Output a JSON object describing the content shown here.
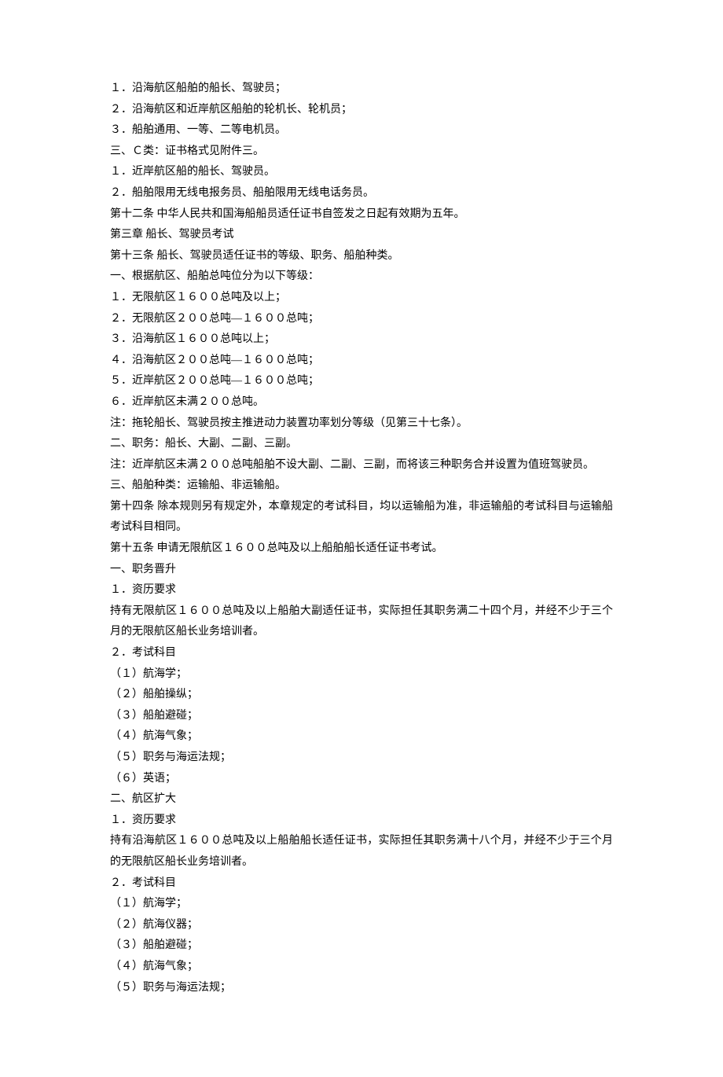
{
  "lines": [
    "１．沿海航区船舶的船长、驾驶员；",
    "２．沿海航区和近岸航区船舶的轮机长、轮机员；",
    "３．船舶通用、一等、二等电机员。",
    "三、Ｃ类：证书格式见附件三。",
    "１．近岸航区船的船长、驾驶员。",
    "２．船舶限用无线电报务员、船舶限用无线电话务员。",
    "第十二条 中华人民共和国海船船员适任证书自签发之日起有效期为五年。",
    "第三章 船长、驾驶员考试",
    "第十三条 船长、驾驶员适任证书的等级、职务、船舶种类。",
    "一、根据航区、船舶总吨位分为以下等级：",
    "１．无限航区１６００总吨及以上；",
    "２．无限航区２００总吨—１６００总吨；",
    "３．沿海航区１６００总吨以上；",
    "４．沿海航区２００总吨—１６００总吨；",
    "５．近岸航区２００总吨—１６００总吨；",
    "６．近岸航区未满２００总吨。",
    "注：拖轮船长、驾驶员按主推进动力装置功率划分等级（见第三十七条）。",
    "二、职务：船长、大副、二副、三副。",
    "注：近岸航区未满２００总吨船舶不设大副、二副、三副，而将该三种职务合并设置为值班驾驶员。",
    "三、船舶种类：运输船、非运输船。",
    "第十四条 除本规则另有规定外，本章规定的考试科目，均以运输船为准，非运输船的考试科目与运输船考试科目相同。",
    "第十五条 申请无限航区１６００总吨及以上船舶船长适任证书考试。",
    "一、职务晋升",
    "１．资历要求",
    "持有无限航区１６００总吨及以上船舶大副适任证书，实际担任其职务满二十四个月，并经不少于三个月的无限航区船长业务培训者。",
    "２．考试科目",
    "（１）航海学；",
    "（２）船舶操纵；",
    "（３）船舶避碰；",
    "（４）航海气象；",
    "（５）职务与海运法规；",
    "（６）英语；",
    "二、航区扩大",
    "１．资历要求",
    "持有沿海航区１６００总吨及以上船舶船长适任证书，实际担任其职务满十八个月，并经不少于三个月的无限航区船长业务培训者。",
    "２．考试科目",
    "（１）航海学；",
    "（２）航海仪器；",
    "（３）船舶避碰；",
    "（４）航海气象；",
    "（５）职务与海运法规；"
  ]
}
